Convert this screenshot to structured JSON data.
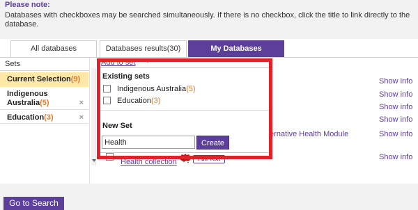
{
  "note": {
    "title": "Please note:",
    "text": "Databases with checkboxes may be searched simultaneously. If there is no checkbox, click the title to link directly to the database."
  },
  "tabs": [
    {
      "label": "All databases"
    },
    {
      "label": "Databases results(30)"
    },
    {
      "label": "My Databases"
    }
  ],
  "sets": {
    "header": "Sets",
    "items": [
      {
        "name": "Current Selection",
        "count": "(9)"
      },
      {
        "name": "Indigenous Australia",
        "count": "(5)",
        "remove": "×"
      },
      {
        "name": "Education",
        "count": "(3)",
        "remove": "×"
      }
    ]
  },
  "add_to_set": {
    "label": "Add to set",
    "existing_heading": "Existing sets",
    "existing": [
      {
        "name": "Indigenous Australia",
        "count": "(5)"
      },
      {
        "name": "Education",
        "count": "(3)"
      }
    ],
    "new_heading": "New Set",
    "new_value": "Health",
    "create_label": "Create"
  },
  "results": {
    "show_info": "Show info",
    "alt_health": "ternative Health Module",
    "health_collection": "Health collection",
    "full_text": "Full Text"
  },
  "footer": {
    "go_label": "Go to Search"
  },
  "colors": {
    "accent": "#5b3f9a",
    "highlight": "#e0222a",
    "count": "#e8792b",
    "current_bg": "#fde8a8"
  },
  "icons": {
    "australia": "australia-map-icon",
    "dropdown": "caret-down-icon",
    "remove": "close-icon"
  }
}
